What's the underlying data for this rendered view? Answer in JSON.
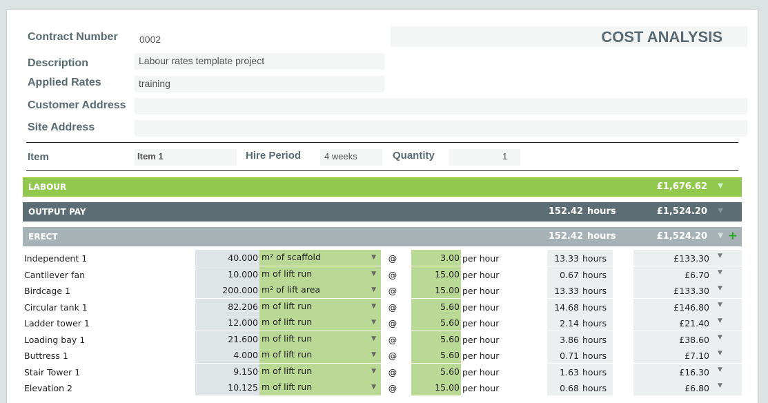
{
  "header": {
    "contract_number_label": "Contract Number",
    "contract_number": "0002",
    "description_label": "Description",
    "description": "Labour rates template project",
    "applied_rates_label": "Applied Rates",
    "applied_rates": "training",
    "customer_address_label": "Customer Address",
    "customer_address": "",
    "site_address_label": "Site Address",
    "site_address": "",
    "title": "COST ANALYSIS"
  },
  "item_bar": {
    "item_label": "Item",
    "item_value": "Item 1",
    "hire_period_label": "Hire Period",
    "hire_period_value": "4 weeks",
    "quantity_label": "Quantity",
    "quantity_value": "1"
  },
  "labour": {
    "label": "LABOUR",
    "amount": "£1,676.62",
    "color": "#92c84e"
  },
  "output_pay": {
    "label": "OUTPUT PAY",
    "hours": "152.42",
    "hours_unit": "hours",
    "amount": "£1,524.20",
    "color": "#5c6e73"
  },
  "erect": {
    "label": "ERECT",
    "hours": "152.42",
    "hours_unit": "hours",
    "amount": "£1,524.20",
    "color": "#a6b2b5"
  },
  "rows": [
    {
      "name": "Independent 1",
      "qty": "40.000",
      "unit": "m² of scaffold",
      "at": "@",
      "rate": "3.00",
      "per": "per hour",
      "hours": "13.33",
      "hours_unit": "hours",
      "amount": "£133.30"
    },
    {
      "name": "Cantilever fan",
      "qty": "10.000",
      "unit": "m of lift run",
      "at": "@",
      "rate": "15.00",
      "per": "per hour",
      "hours": "0.67",
      "hours_unit": "hours",
      "amount": "£6.70"
    },
    {
      "name": "Birdcage 1",
      "qty": "200.000",
      "unit": "m² of lift area",
      "at": "@",
      "rate": "15.00",
      "per": "per hour",
      "hours": "13.33",
      "hours_unit": "hours",
      "amount": "£133.30"
    },
    {
      "name": "Circular tank 1",
      "qty": "82.206",
      "unit": "m of lift run",
      "at": "@",
      "rate": "5.60",
      "per": "per hour",
      "hours": "14.68",
      "hours_unit": "hours",
      "amount": "£146.80"
    },
    {
      "name": "Ladder tower 1",
      "qty": "12.000",
      "unit": "m of lift run",
      "at": "@",
      "rate": "5.60",
      "per": "per hour",
      "hours": "2.14",
      "hours_unit": "hours",
      "amount": "£21.40"
    },
    {
      "name": "Loading bay 1",
      "qty": "21.600",
      "unit": "m of lift run",
      "at": "@",
      "rate": "5.60",
      "per": "per hour",
      "hours": "3.86",
      "hours_unit": "hours",
      "amount": "£38.60"
    },
    {
      "name": "Buttress 1",
      "qty": "4.000",
      "unit": "m of lift run",
      "at": "@",
      "rate": "5.60",
      "per": "per hour",
      "hours": "0.71",
      "hours_unit": "hours",
      "amount": "£7.10"
    },
    {
      "name": "Stair Tower 1",
      "qty": "9.150",
      "unit": "m of lift run",
      "at": "@",
      "rate": "5.60",
      "per": "per hour",
      "hours": "1.63",
      "hours_unit": "hours",
      "amount": "£16.30"
    },
    {
      "name": "Elevation 2",
      "qty": "10.125",
      "unit": "m of lift run",
      "at": "@",
      "rate": "15.00",
      "per": "per hour",
      "hours": "0.68",
      "hours_unit": "hours",
      "amount": "£6.80"
    }
  ]
}
